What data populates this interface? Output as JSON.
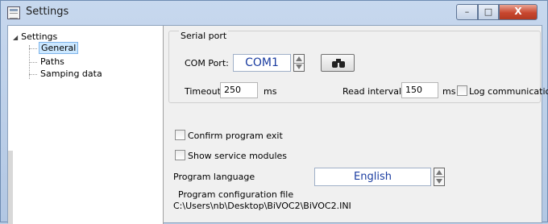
{
  "window": {
    "title": "Settings",
    "controls": {
      "minimize": "–",
      "maximize": "□",
      "close": "X"
    }
  },
  "tree": {
    "root": "Settings",
    "items": [
      {
        "label": "General",
        "selected": true
      },
      {
        "label": "Paths",
        "selected": false
      },
      {
        "label": "Samping data",
        "selected": false
      }
    ]
  },
  "serial": {
    "group_title": "Serial port",
    "com_port_label": "COM Port:",
    "com_port_value": "COM1",
    "timeout_label": "Timeout:",
    "timeout_value": "250",
    "timeout_unit": "ms",
    "read_interval_label": "Read interval:",
    "read_interval_value": "150",
    "read_interval_unit": "ms",
    "log_label": "Log communication",
    "log_checked": false
  },
  "options": {
    "confirm_exit_label": "Confirm program exit",
    "confirm_exit_checked": false,
    "service_modules_label": "Show service modules",
    "service_modules_checked": false,
    "language_label": "Program language",
    "language_value": "English"
  },
  "config": {
    "title": "Program configuration file",
    "path": "C:\\Users\\nb\\Desktop\\BiVOC2\\BiVOC2.INI"
  }
}
